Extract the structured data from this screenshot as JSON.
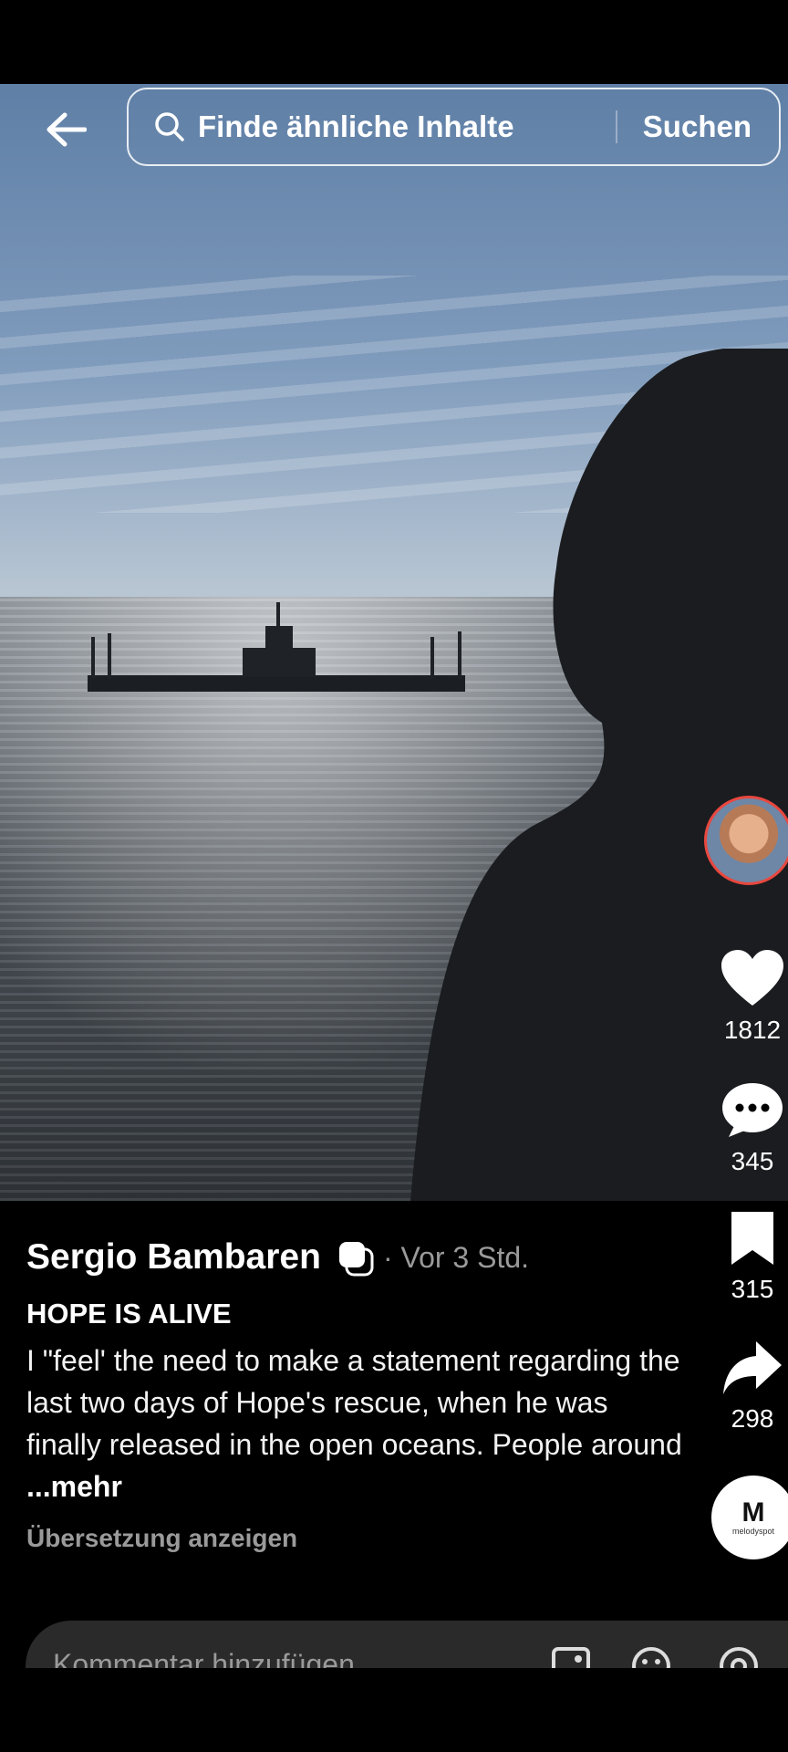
{
  "search": {
    "placeholder": "Finde ähnliche Inhalte",
    "button": "Suchen"
  },
  "post": {
    "author": "Sergio Bambaren",
    "time": "· Vor 3 Std.",
    "title": "HOPE IS ALIVE",
    "description": "I \"feel' the need to make a statement regarding the last two days of Hope's rescue, when he was finally  released in the open oceans. People around ",
    "more": "...mehr",
    "translate": "Übersetzung anzeigen"
  },
  "actions": {
    "likes": "1812",
    "comments": "345",
    "saves": "315",
    "shares": "298"
  },
  "music": {
    "logo": "M",
    "label": "melodyspot"
  },
  "comment_bar": {
    "placeholder": "Kommentar hinzufügen"
  },
  "icons": [
    "back-arrow-icon",
    "search-icon",
    "verified-icon",
    "heart-icon",
    "comment-icon",
    "bookmark-icon",
    "share-icon",
    "image-icon",
    "emoji-icon",
    "at-icon"
  ]
}
